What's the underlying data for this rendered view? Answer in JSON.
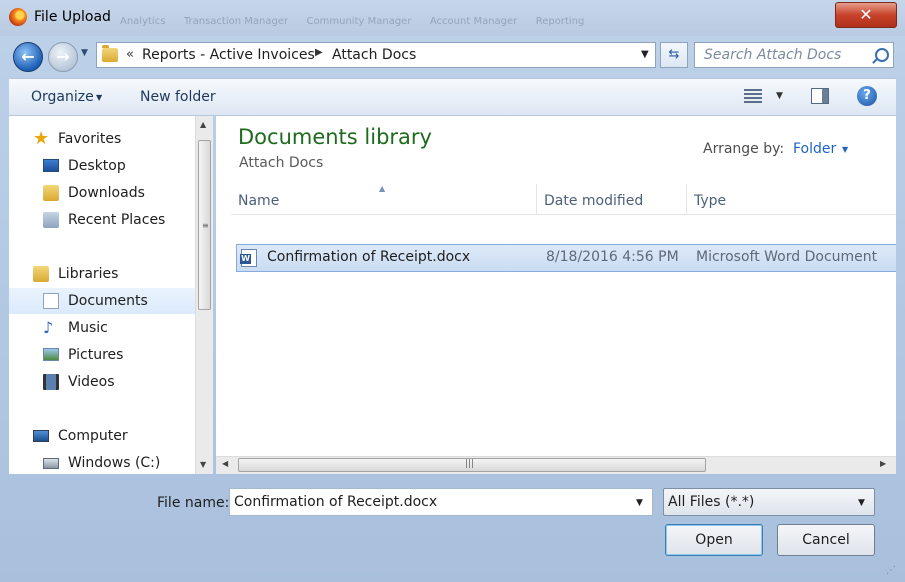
{
  "window": {
    "title": "File Upload",
    "background_tabs": [
      "Analytics",
      "Transaction Manager",
      "Community Manager",
      "Account Manager",
      "Reporting"
    ],
    "close_label": "✕"
  },
  "address": {
    "overflow": "«",
    "crumbs": [
      "Reports - Active Invoices",
      "Attach Docs"
    ],
    "separator": "▶",
    "dropdown": "▼",
    "refresh_symbol": "⇆"
  },
  "search": {
    "placeholder": "Search Attach Docs"
  },
  "toolbar": {
    "organize_label": "Organize",
    "new_folder_label": "New folder",
    "dropdown": "▼",
    "help_label": "?"
  },
  "nav": {
    "favorites_label": "Favorites",
    "favorites": [
      "Desktop",
      "Downloads",
      "Recent Places"
    ],
    "libraries_label": "Libraries",
    "libraries": [
      "Documents",
      "Music",
      "Pictures",
      "Videos"
    ],
    "computer_label": "Computer",
    "drives": [
      "Windows (C:)"
    ],
    "selected": "Documents",
    "scroll_up": "▲",
    "scroll_down": "▼",
    "grip": "≡"
  },
  "content": {
    "library_title": "Documents library",
    "library_subtitle": "Attach Docs",
    "arrange_label": "Arrange by:",
    "arrange_value": "Folder",
    "sort_indicator": "▲",
    "columns": [
      "Name",
      "Date modified",
      "Type"
    ],
    "files": [
      {
        "name": "Confirmation of Receipt.docx",
        "date": "8/18/2016 4:56 PM",
        "type": "Microsoft Word Document"
      }
    ],
    "scroll_left": "◀",
    "scroll_right": "▶",
    "grip": "|||"
  },
  "footer": {
    "file_name_label": "File name:",
    "file_name_value": "Confirmation of Receipt.docx",
    "file_type_value": "All Files (*.*)",
    "open_label": "Open",
    "cancel_label": "Cancel",
    "dropdown": "▼",
    "resize_grip": "⋰"
  },
  "colors": {
    "title_green": "#1e6b1e",
    "link_blue": "#1e63c8",
    "selection": "#cbdcf2",
    "close_red": "#c8432b"
  }
}
